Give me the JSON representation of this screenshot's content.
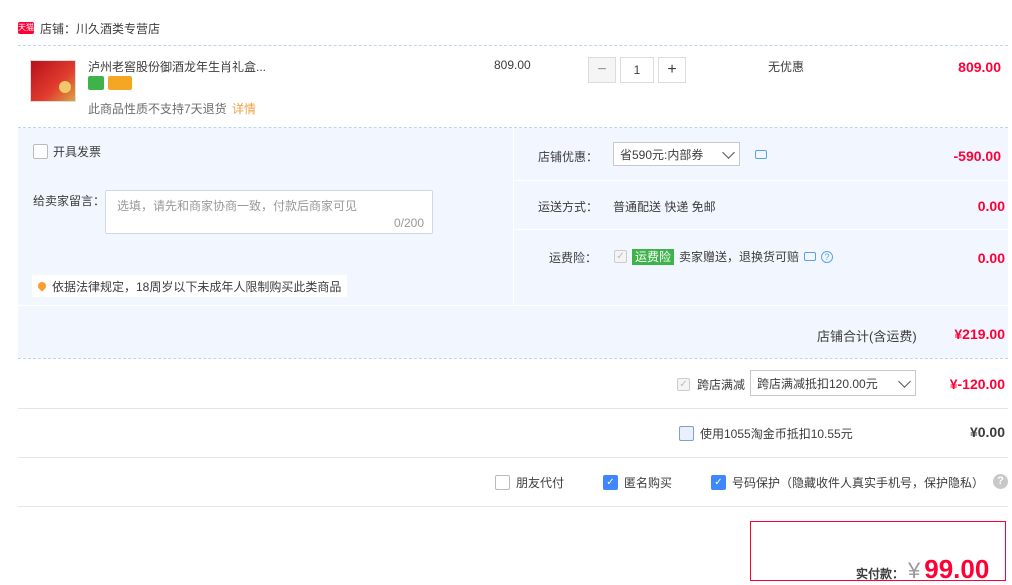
{
  "shop": {
    "badge": "天猫",
    "label": "店铺：川久酒类专营店"
  },
  "product": {
    "name": "泸州老窖股份御酒龙年生肖礼盒...",
    "no_return_text": "此商品性质不支持7天退货",
    "detail_link": "详情",
    "unit_price": "809.00",
    "quantity": "1",
    "minus": "−",
    "plus": "+",
    "discount_text": "无优惠",
    "subtotal": "809.00"
  },
  "invoice": {
    "label": "开具发票",
    "checked": false
  },
  "message": {
    "label": "给卖家留言：",
    "placeholder": "选填，请先和商家协商一致，付款后商家可见",
    "counter": "0/200"
  },
  "notice": {
    "text": "依据法律规定，18周岁以下未成年人限制购买此类商品"
  },
  "shop_discount": {
    "label": "店铺优惠：",
    "selected": "省590元:内部券",
    "amount": "-590.00"
  },
  "shipping": {
    "label": "运送方式：",
    "value": "普通配送 快递 免邮",
    "amount": "0.00"
  },
  "insurance": {
    "label": "运费险：",
    "tag": "运费险",
    "text": "卖家赠送，退换货可赔",
    "amount": "0.00"
  },
  "shop_total": {
    "label": "店铺合计(含运费)",
    "amount": "¥219.00"
  },
  "cross_store": {
    "label": "跨店满减",
    "selected": "跨店满减抵扣120.00元",
    "amount": "¥-120.00"
  },
  "coins": {
    "label": "使用1055淘金币抵扣10.55元",
    "amount": "¥0.00"
  },
  "options": {
    "friend_pay": "朋友代付",
    "anonymous": "匿名购买",
    "number_protect": "号码保护（隐藏收件人真实手机号，保护隐私）",
    "help": "?"
  },
  "payment": {
    "label": "实付款：",
    "currency": "¥",
    "amount": "99.00"
  },
  "colors": {
    "accent_red": "#ff0036",
    "panel_blue": "#f2f7ff",
    "check_blue": "#3f86ff",
    "green_tag": "#3db34a"
  }
}
